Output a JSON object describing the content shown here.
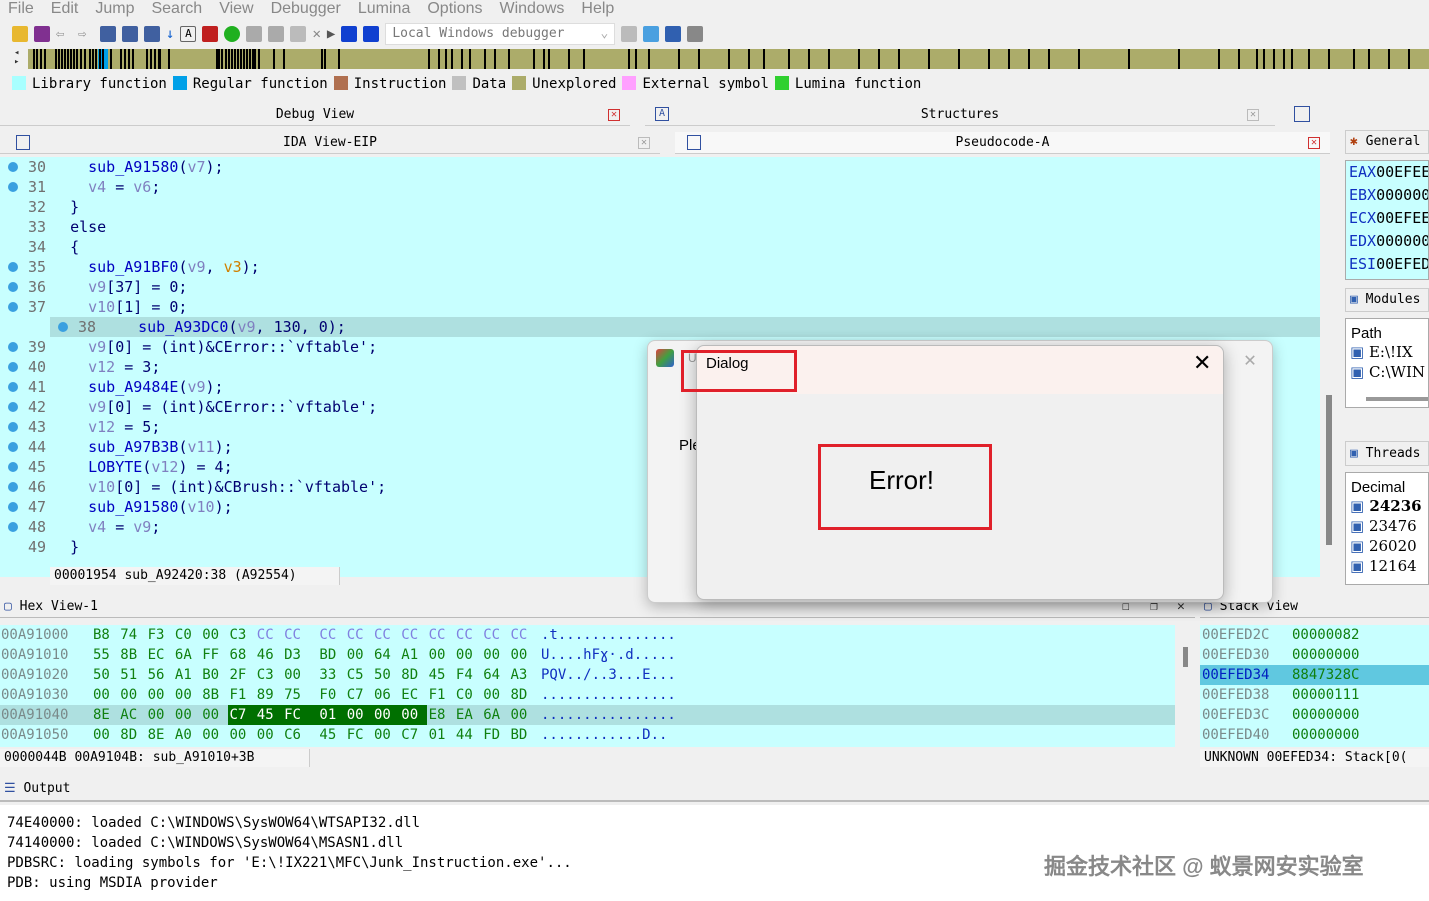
{
  "menu": [
    "File",
    "Edit",
    "Jump",
    "Search",
    "View",
    "Debugger",
    "Lumina",
    "Options",
    "Windows",
    "Help"
  ],
  "toolbar": {
    "debugger_select": "Local Windows debugger"
  },
  "legend": [
    {
      "label": "Library function",
      "color": "#a8ffff"
    },
    {
      "label": "Regular function",
      "color": "#00a0e8"
    },
    {
      "label": "Instruction",
      "color": "#b07050"
    },
    {
      "label": "Data",
      "color": "#c0c0c0"
    },
    {
      "label": "Unexplored",
      "color": "#acac6a"
    },
    {
      "label": "External symbol",
      "color": "#ffa0ff"
    },
    {
      "label": "Lumina function",
      "color": "#30d030"
    }
  ],
  "panels": {
    "debug_view": "Debug View",
    "structures": "Structures",
    "ida_view": "IDA View-EIP",
    "pseudocode": "Pseudocode-A",
    "hex_view": "Hex View-1",
    "stack_view": "Stack view",
    "output": "Output",
    "general": "General registers",
    "modules": "Modules",
    "threads": "Threads"
  },
  "code": {
    "lines": [
      {
        "no": "30",
        "dot": true,
        "indent": "    ",
        "tokens": [
          [
            "sub_A91580",
            "f"
          ],
          [
            "(",
            "p"
          ],
          [
            "v7",
            "v"
          ],
          [
            ");",
            "p"
          ]
        ]
      },
      {
        "no": "31",
        "dot": true,
        "indent": "    ",
        "tokens": [
          [
            "v4",
            "v"
          ],
          [
            " = ",
            "p"
          ],
          [
            "v6",
            "v"
          ],
          [
            ";",
            "p"
          ]
        ]
      },
      {
        "no": "32",
        "dot": false,
        "indent": "  ",
        "tokens": [
          [
            "}",
            "p"
          ]
        ]
      },
      {
        "no": "33",
        "dot": false,
        "indent": "  ",
        "tokens": [
          [
            "else",
            "p"
          ]
        ]
      },
      {
        "no": "34",
        "dot": false,
        "indent": "  ",
        "tokens": [
          [
            "{",
            "p"
          ]
        ]
      },
      {
        "no": "35",
        "dot": true,
        "indent": "    ",
        "tokens": [
          [
            "sub_A91BF0",
            "f"
          ],
          [
            "(",
            "p"
          ],
          [
            "v9",
            "v"
          ],
          [
            ", ",
            "p"
          ],
          [
            "v3",
            "a"
          ],
          [
            ");",
            "p"
          ]
        ]
      },
      {
        "no": "36",
        "dot": true,
        "indent": "    ",
        "tokens": [
          [
            "v9",
            "v"
          ],
          [
            "[37] = 0;",
            "p"
          ]
        ]
      },
      {
        "no": "37",
        "dot": true,
        "indent": "    ",
        "tokens": [
          [
            "v10",
            "v"
          ],
          [
            "[1] = 0;",
            "p"
          ]
        ]
      },
      {
        "no": "38",
        "dot": true,
        "indent": "    ",
        "highlight": true,
        "tokens": [
          [
            "sub_A93DC0",
            "f"
          ],
          [
            "(",
            "p"
          ],
          [
            "v9",
            "v"
          ],
          [
            ", 130, 0);",
            "p"
          ]
        ]
      },
      {
        "no": "39",
        "dot": true,
        "indent": "    ",
        "tokens": [
          [
            "v9",
            "v"
          ],
          [
            "[0] = (int)&CError::`vftable';",
            "p"
          ]
        ]
      },
      {
        "no": "40",
        "dot": true,
        "indent": "    ",
        "tokens": [
          [
            "v12",
            "v"
          ],
          [
            " = 3;",
            "p"
          ]
        ]
      },
      {
        "no": "41",
        "dot": true,
        "indent": "    ",
        "tokens": [
          [
            "sub_A9484E",
            "f"
          ],
          [
            "(",
            "p"
          ],
          [
            "v9",
            "v"
          ],
          [
            ");",
            "p"
          ]
        ]
      },
      {
        "no": "42",
        "dot": true,
        "indent": "    ",
        "tokens": [
          [
            "v9",
            "v"
          ],
          [
            "[0] = (int)&CError::`vftable';",
            "p"
          ]
        ]
      },
      {
        "no": "43",
        "dot": true,
        "indent": "    ",
        "tokens": [
          [
            "v12",
            "v"
          ],
          [
            " = 5;",
            "p"
          ]
        ]
      },
      {
        "no": "44",
        "dot": true,
        "indent": "    ",
        "tokens": [
          [
            "sub_A97B3B",
            "f"
          ],
          [
            "(",
            "p"
          ],
          [
            "v11",
            "v"
          ],
          [
            ");",
            "p"
          ]
        ]
      },
      {
        "no": "45",
        "dot": true,
        "indent": "    ",
        "tokens": [
          [
            "LOBYTE",
            "f"
          ],
          [
            "(",
            "p"
          ],
          [
            "v12",
            "v"
          ],
          [
            ") = 4;",
            "p"
          ]
        ]
      },
      {
        "no": "46",
        "dot": true,
        "indent": "    ",
        "tokens": [
          [
            "v10",
            "v"
          ],
          [
            "[0] = (int)&CBrush::`vftable';",
            "p"
          ]
        ]
      },
      {
        "no": "47",
        "dot": true,
        "indent": "    ",
        "tokens": [
          [
            "sub_A91580",
            "f"
          ],
          [
            "(",
            "p"
          ],
          [
            "v10",
            "v"
          ],
          [
            ");",
            "p"
          ]
        ]
      },
      {
        "no": "48",
        "dot": true,
        "indent": "    ",
        "tokens": [
          [
            "v4",
            "v"
          ],
          [
            " = ",
            "p"
          ],
          [
            "v9",
            "v"
          ],
          [
            ";",
            "p"
          ]
        ]
      },
      {
        "no": "49",
        "dot": false,
        "indent": "  ",
        "tokens": [
          [
            "}",
            "p"
          ]
        ]
      }
    ],
    "status": "00001954 sub_A92420:38 (A92554)"
  },
  "hex": {
    "rows": [
      {
        "addr": "00A91000",
        "bytes": [
          "B8",
          "74",
          "F3",
          "C0",
          "00",
          "C3",
          "CC",
          "CC",
          "CC",
          "CC",
          "CC",
          "CC",
          "CC",
          "CC",
          "CC",
          "CC"
        ],
        "ascii": ".t.............."
      },
      {
        "addr": "00A91010",
        "bytes": [
          "55",
          "8B",
          "EC",
          "6A",
          "FF",
          "68",
          "46",
          "D3",
          "BD",
          "00",
          "64",
          "A1",
          "00",
          "00",
          "00",
          "00"
        ],
        "ascii": "U....hFɣ·.d....."
      },
      {
        "addr": "00A91020",
        "bytes": [
          "50",
          "51",
          "56",
          "A1",
          "B0",
          "2F",
          "C3",
          "00",
          "33",
          "C5",
          "50",
          "8D",
          "45",
          "F4",
          "64",
          "A3"
        ],
        "ascii": "PQV../..3...E..."
      },
      {
        "addr": "00A91030",
        "bytes": [
          "00",
          "00",
          "00",
          "00",
          "8B",
          "F1",
          "89",
          "75",
          "F0",
          "C7",
          "06",
          "EC",
          "F1",
          "C0",
          "00",
          "8D"
        ],
        "ascii": "................"
      },
      {
        "addr": "00A91040",
        "bytes": [
          "8E",
          "AC",
          "00",
          "00",
          "00",
          "C7",
          "45",
          "FC",
          "01",
          "00",
          "00",
          "00",
          "E8",
          "EA",
          "6A",
          "00"
        ],
        "ascii": "................",
        "highlight": true,
        "selected": [
          5,
          11
        ]
      },
      {
        "addr": "00A91050",
        "bytes": [
          "00",
          "8D",
          "8E",
          "A0",
          "00",
          "00",
          "00",
          "C6",
          "45",
          "FC",
          "00",
          "C7",
          "01",
          "44",
          "FD",
          "BD"
        ],
        "ascii": "............D.."
      }
    ],
    "status": "0000044B 00A9104B: sub_A91010+3B"
  },
  "stack": {
    "rows": [
      {
        "addr": "00EFED2C",
        "val": "00000082"
      },
      {
        "addr": "00EFED30",
        "val": "00000000"
      },
      {
        "addr": "00EFED34",
        "val": "8847328C",
        "selected": true
      },
      {
        "addr": "00EFED38",
        "val": "00000111"
      },
      {
        "addr": "00EFED3C",
        "val": "00000000"
      },
      {
        "addr": "00EFED40",
        "val": "00000000"
      }
    ],
    "status": "UNKNOWN 00EFED34: Stack[0("
  },
  "registers": [
    {
      "name": "EAX",
      "val": "00EFEE"
    },
    {
      "name": "EBX",
      "val": "000000"
    },
    {
      "name": "ECX",
      "val": "00EFEE"
    },
    {
      "name": "EDX",
      "val": "000000"
    },
    {
      "name": "ESI",
      "val": "00EFED"
    }
  ],
  "modules": {
    "header": "Path",
    "items": [
      "E:\\!IX",
      "C:\\WIN"
    ]
  },
  "threads": {
    "header": "Decimal",
    "items": [
      "24236",
      "23476",
      "26020",
      "12164"
    ]
  },
  "output": {
    "lines": [
      "74E40000: loaded C:\\WINDOWS\\SysWOW64\\WTSAPI32.dll",
      "74140000: loaded C:\\WINDOWS\\SysWOW64\\MSASN1.dll",
      "PDBSRC: loading symbols for 'E:\\!IX221\\MFC\\Junk_Instruction.exe'...",
      "PDB: using MSDIA provider"
    ],
    "watermark": "掘金技术社区 @ 蚁景网安实验室"
  },
  "back_dialog": {
    "title_fragment": "U",
    "text_fragment": "Ple"
  },
  "dialog": {
    "title": "Dialog",
    "message": "Error!"
  }
}
